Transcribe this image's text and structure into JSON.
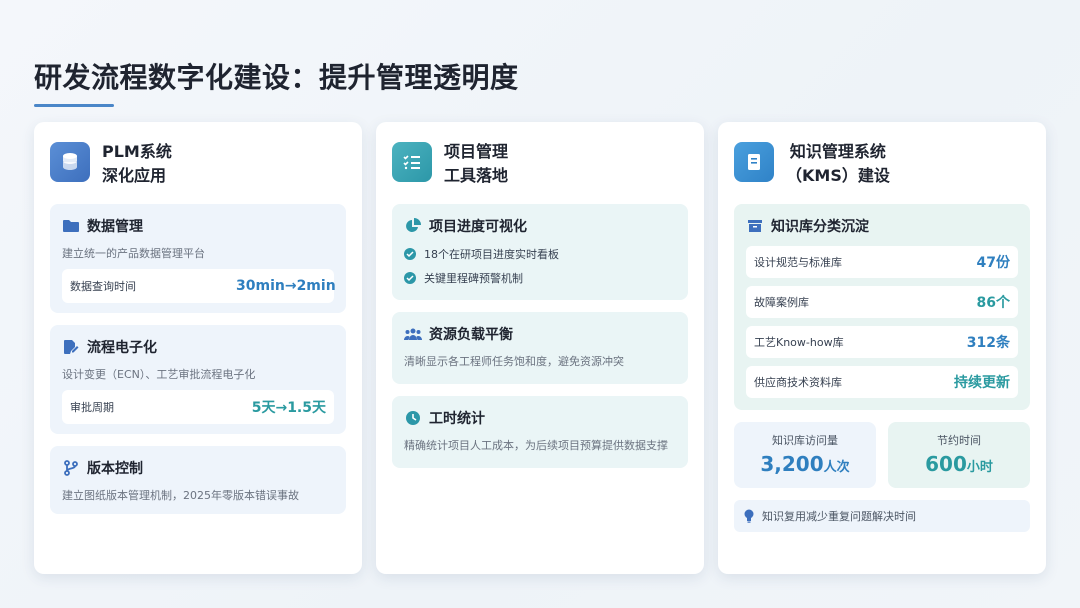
{
  "title": "研发流程数字化建设：提升管理透明度",
  "colors": {
    "accent": "#4a86c8",
    "blue": "#2f7fbf",
    "teal": "#2a9aa0"
  },
  "cards": [
    {
      "icon": "database-icon",
      "title_line1": "PLM系统",
      "title_line2": "深化应用",
      "sections": [
        {
          "icon": "folder-icon",
          "title": "数据管理",
          "desc": "建立统一的产品数据管理平台",
          "metric_label": "数据查询时间",
          "metric_value": "30min→2min"
        },
        {
          "icon": "edit-document-icon",
          "title": "流程电子化",
          "desc": "设计变更（ECN）、工艺审批流程电子化",
          "metric_label": "审批周期",
          "metric_value": "5天→1.5天"
        },
        {
          "icon": "branch-icon",
          "title": "版本控制",
          "desc": "建立图纸版本管理机制，2025年零版本错误事故"
        }
      ]
    },
    {
      "icon": "checklist-icon",
      "title_line1": "项目管理",
      "title_line2": "工具落地",
      "sections": [
        {
          "icon": "pie-chart-icon",
          "title": "项目进度可视化",
          "items": [
            "18个在研项目进度实时看板",
            "关键里程碑预警机制"
          ]
        },
        {
          "icon": "users-icon",
          "title": "资源负载平衡",
          "desc": "清晰显示各工程师任务饱和度，避免资源冲突"
        },
        {
          "icon": "clock-icon",
          "title": "工时统计",
          "desc": "精确统计项目人工成本，为后续项目预算提供数据支撑"
        }
      ]
    },
    {
      "icon": "book-icon",
      "title_line1": "知识管理系统",
      "title_line2": "（KMS）建设",
      "kb_title": "知识库分类沉淀",
      "kb_rows": [
        {
          "label": "设计规范与标准库",
          "value": "47份"
        },
        {
          "label": "故障案例库",
          "value": "86个"
        },
        {
          "label": "工艺Know-how库",
          "value": "312条"
        },
        {
          "label": "供应商技术资料库",
          "value": "持续更新"
        }
      ],
      "stats": [
        {
          "label": "知识库访问量",
          "value": "3,200",
          "unit": "人次"
        },
        {
          "label": "节约时间",
          "value": "600",
          "unit": "小时"
        }
      ],
      "tip": "知识复用减少重复问题解决时间"
    }
  ]
}
